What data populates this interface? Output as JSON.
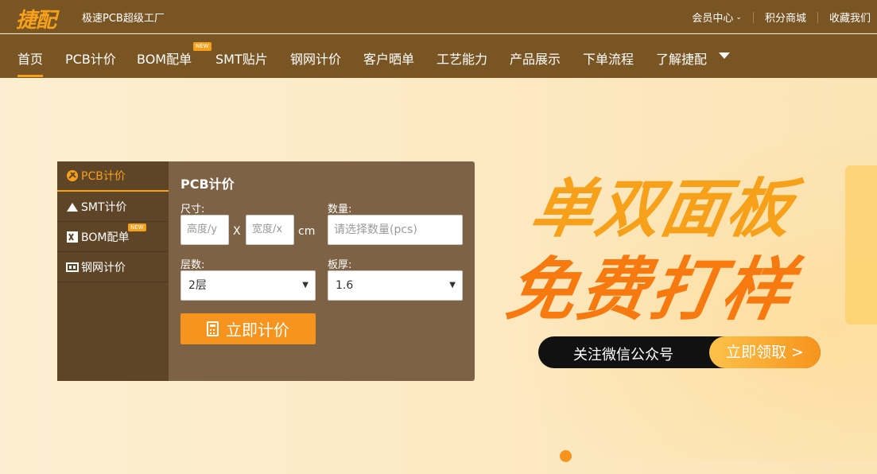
{
  "header": {
    "logo": "捷配",
    "slogan": "极速PCB超级工厂",
    "links": [
      "会员中心",
      "积分商城",
      "收藏我们"
    ]
  },
  "nav": {
    "items": [
      "首页",
      "PCB计价",
      "BOM配单",
      "SMT贴片",
      "钢网计价",
      "客户晒单",
      "工艺能力",
      "产品展示",
      "下单流程",
      "了解捷配"
    ],
    "new_badge": "NEW",
    "active_index": 0
  },
  "panel": {
    "tabs": [
      "PCB计价",
      "SMT计价",
      "BOM配单",
      "钢网计价"
    ],
    "tab_badge": "NEW",
    "title": "PCB计价",
    "size_label": "尺寸:",
    "height_placeholder": "高度/y",
    "times": "X",
    "width_placeholder": "宽度/x",
    "unit": "cm",
    "qty_label": "数量:",
    "qty_placeholder": "请选择数量(pcs)",
    "layers_label": "层数:",
    "layers_value": "2层",
    "thickness_label": "板厚:",
    "thickness_value": "1.6",
    "quote_button": "立即计价"
  },
  "banner": {
    "line1": "单双面板",
    "line2": "免费打样",
    "cta_text": "关注微信公众号",
    "cta_button": "立即领取 >"
  },
  "colors": {
    "header_bg": "#7a5524",
    "accent": "#f7a11a",
    "panel_bg": "#7e6245",
    "panel_side": "#5e4527"
  }
}
